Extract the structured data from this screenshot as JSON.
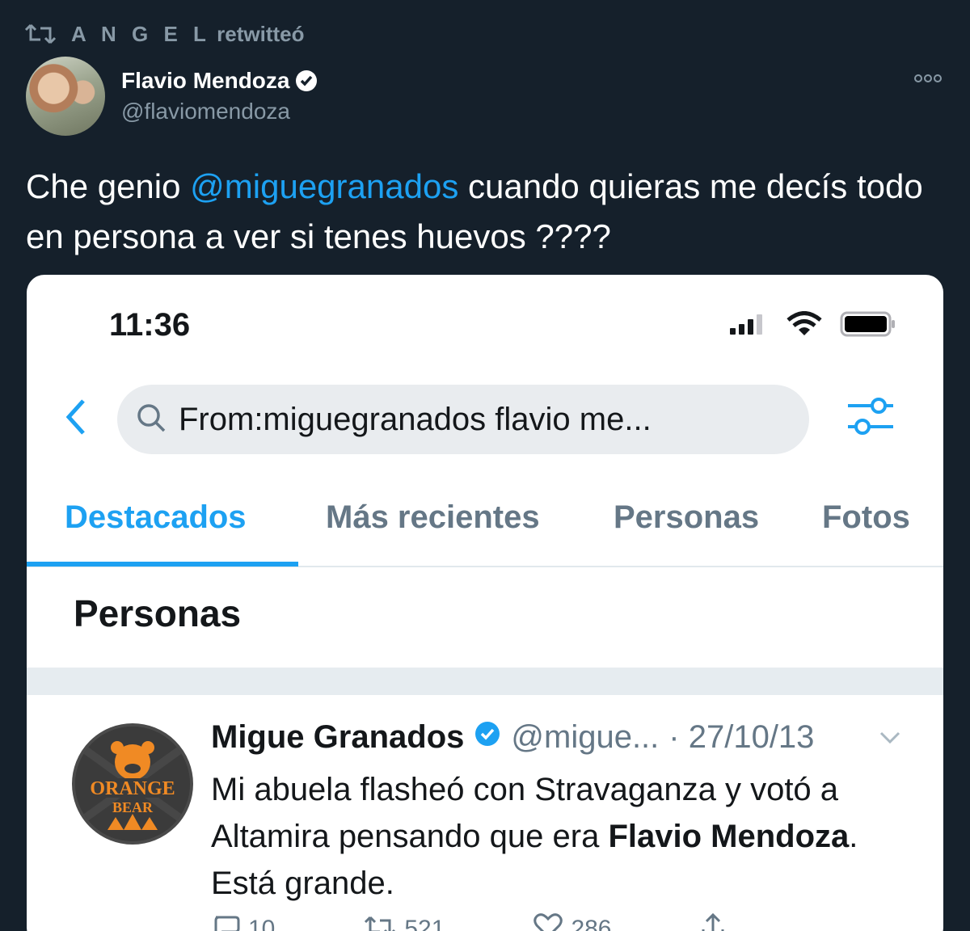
{
  "retweet": {
    "user": "A N G E L",
    "suffix": " retwitteó"
  },
  "author": {
    "name": "Flavio Mendoza",
    "handle": "@flaviomendoza"
  },
  "tweet": {
    "pre": "Che genio ",
    "mention": "@miguegranados",
    "post": " cuando quieras me decís todo en persona a ver si tenes huevos ????"
  },
  "screenshot": {
    "time": "11:36",
    "search_query": "From:miguegranados  flavio me...",
    "tabs": [
      "Destacados",
      "Más recientes",
      "Personas",
      "Fotos"
    ],
    "section_title": "Personas",
    "inner_tweet": {
      "name": "Migue Granados",
      "handle": "@migue...",
      "date": "· 27/10/13",
      "avatar_text_top": "ORANGE",
      "avatar_text_bottom": "BEAR",
      "text_pre": "Mi abuela flasheó con Stravaganza y votó a Altamira pensando que era ",
      "text_bold": "Flavio Mendoza",
      "text_post": ". Está grande.",
      "replies": "10",
      "retweets": "521",
      "likes": "286"
    }
  },
  "colors": {
    "background": "#15202b",
    "accent": "#1da1f2",
    "muted": "#8899a6"
  }
}
